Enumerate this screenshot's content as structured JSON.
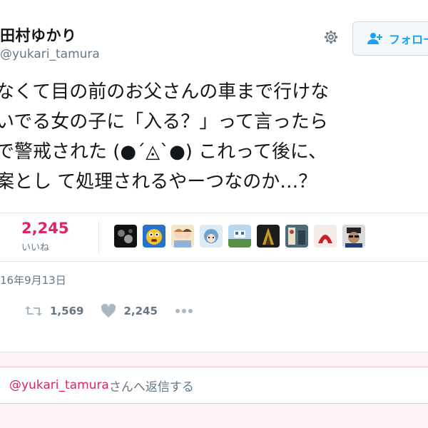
{
  "user": {
    "display_name": "田村ゆかり",
    "screen_name": "@yukari_tamura",
    "follow_label": "フォロー"
  },
  "tweet": {
    "lines": [
      "なくて目の前のお父さんの車まで行けな",
      "いでる女の子に「入る？」って言ったら",
      "で警戒された (●´◬`●) これって後に、",
      "案とし て処理されるやーつなのか…？"
    ]
  },
  "stats": {
    "likes_count": "2,245",
    "likes_label": "いいね",
    "avatars": [
      "avatar-1",
      "avatar-2",
      "avatar-3",
      "avatar-4",
      "avatar-5",
      "avatar-6",
      "avatar-7",
      "avatar-8",
      "avatar-9"
    ]
  },
  "date": "16年9月13日",
  "actions": {
    "retweet_count": "1,569",
    "like_count": "2,245",
    "more_icon": "more-icon"
  },
  "reply": {
    "mention": "@yukari_tamura",
    "suffix": "さんへ返信する"
  },
  "colors": {
    "like": "#e0245e",
    "link": "#1da1f2",
    "muted": "#657786",
    "reply_bg": "#fdf2f5"
  }
}
